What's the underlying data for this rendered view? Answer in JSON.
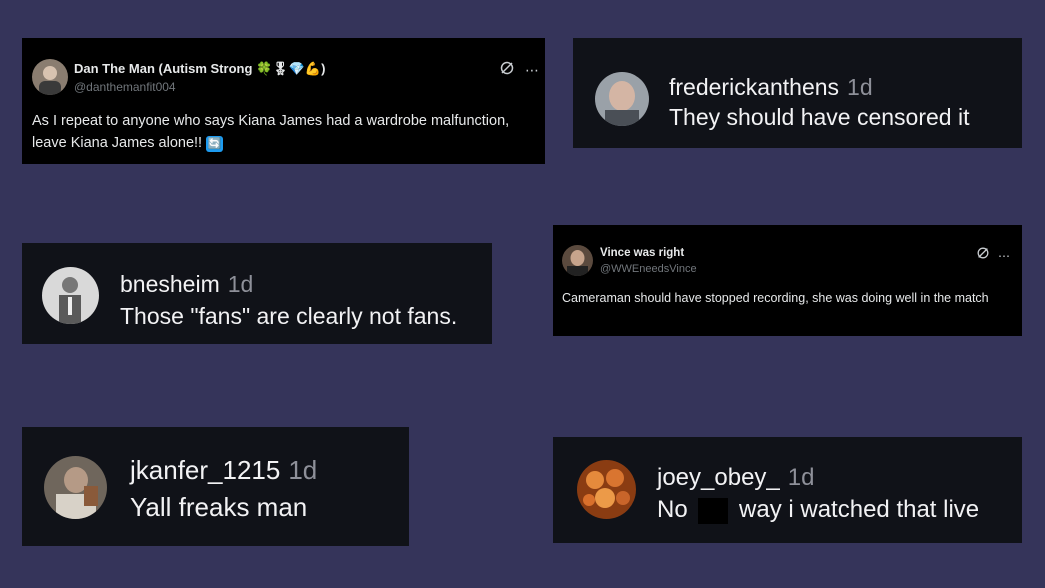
{
  "tweets": [
    {
      "name": "Dan The Man (Autism Strong",
      "name_emojis": "🍀🎖💎💪)",
      "handle": "@danthemanfit004",
      "body": "As I repeat to anyone who says Kiana James had a wardrobe malfunction, leave Kiana James alone!!",
      "body_emoji": "🔄"
    },
    {
      "name": "Vince was right",
      "handle": "@WWEneedsVince",
      "body": "Cameraman should have stopped recording, she was doing well in the match"
    }
  ],
  "comments": [
    {
      "username": "frederickanthens",
      "age": "1d",
      "text": "They should have censored it"
    },
    {
      "username": "bnesheim",
      "age": "1d",
      "text": "Those \"fans\" are clearly not fans."
    },
    {
      "username": "jkanfer_1215",
      "age": "1d",
      "text": "Yall freaks man"
    },
    {
      "username": "joey_obey_",
      "age": "1d",
      "text_before": "No",
      "text_after": "way i watched that live"
    }
  ],
  "icons": {
    "grok": "grok-icon",
    "more": "more-options-icon"
  },
  "colors": {
    "background": "#35345a",
    "tweet_card": "#000000",
    "comment_card": "#101218",
    "muted_text": "#71767b"
  }
}
